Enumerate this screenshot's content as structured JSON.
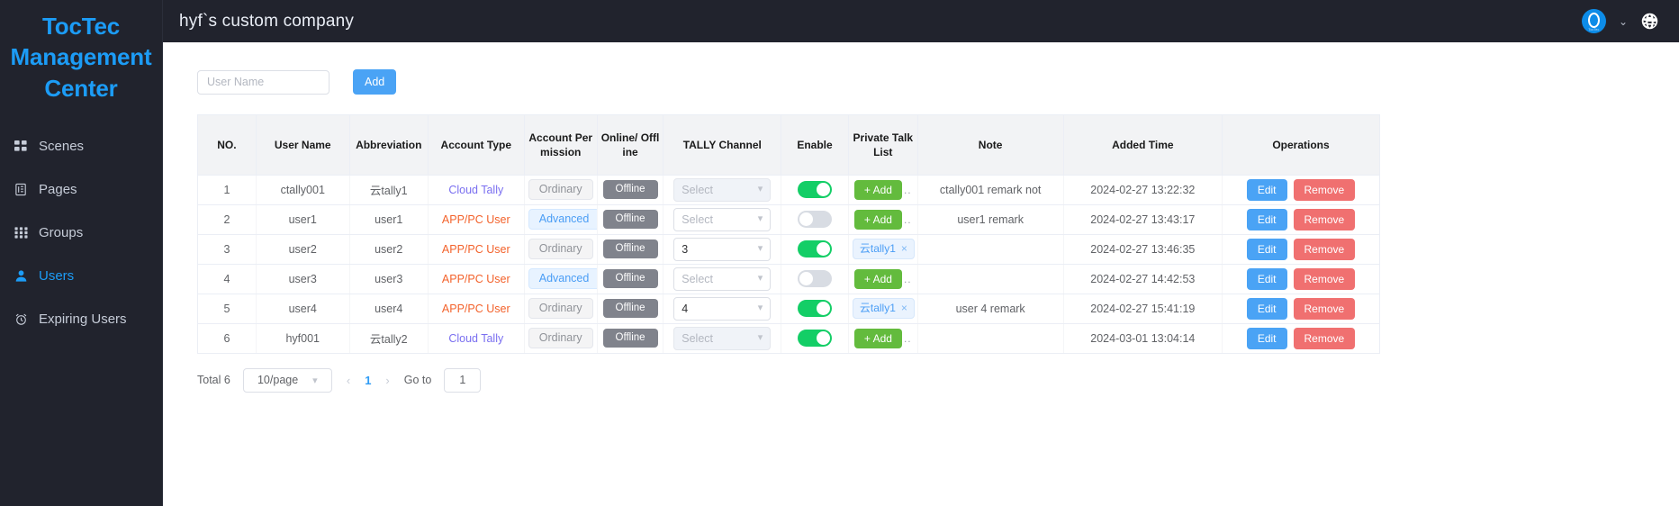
{
  "sidebar": {
    "brand": "TocTec Management Center",
    "items": [
      {
        "label": "Scenes",
        "icon": "grid-2x2-icon",
        "active": false
      },
      {
        "label": "Pages",
        "icon": "document-icon",
        "active": false
      },
      {
        "label": "Groups",
        "icon": "grid-3x3-icon",
        "active": false
      },
      {
        "label": "Users",
        "icon": "user-icon",
        "active": true
      },
      {
        "label": "Expiring Users",
        "icon": "alarm-clock-icon",
        "active": false
      }
    ]
  },
  "topbar": {
    "title": "hyf`s custom company",
    "avatar_caption": "TocTec",
    "chevron": "⌄",
    "globe_icon": "globe-icon"
  },
  "toolbar": {
    "search_placeholder": "User Name",
    "search_value": "",
    "add_label": "Add"
  },
  "table": {
    "headers": [
      "NO.",
      "User Name",
      "Abbreviation",
      "Account Type",
      "Account Permission",
      "Online/ Offline",
      "TALLY Channel",
      "Enable",
      "Private Talk List",
      "Note",
      "Added Time",
      "Operations"
    ],
    "select_placeholder": "Select",
    "offline_label": "Offline",
    "add_tag_label": "+ Add",
    "more_ellipsis": "..",
    "edit_label": "Edit",
    "remove_label": "Remove",
    "tag_close": "×",
    "rows": [
      {
        "no": "1",
        "user_name": "ctally001",
        "abbreviation": "云tally1",
        "account_type": "Cloud Tally",
        "account_type_kind": "cloud",
        "permission": "Ordinary",
        "permission_kind": "ordinary",
        "permission_more": "",
        "online": "Offline",
        "tally_channel": "",
        "tally_disabled": true,
        "enabled": true,
        "talk_kind": "add",
        "talk_tag": "",
        "talk_more": "..",
        "note": "ctally001 remark not",
        "added_time": "2024-02-27 13:22:32"
      },
      {
        "no": "2",
        "user_name": "user1",
        "abbreviation": "user1",
        "account_type": "APP/PC User",
        "account_type_kind": "app",
        "permission": "Advanced",
        "permission_kind": "advanced",
        "permission_more": "..",
        "online": "Offline",
        "tally_channel": "",
        "tally_disabled": false,
        "enabled": false,
        "talk_kind": "add",
        "talk_tag": "",
        "talk_more": "..",
        "note": "user1 remark",
        "added_time": "2024-02-27 13:43:17"
      },
      {
        "no": "3",
        "user_name": "user2",
        "abbreviation": "user2",
        "account_type": "APP/PC User",
        "account_type_kind": "app",
        "permission": "Ordinary",
        "permission_kind": "ordinary",
        "permission_more": "",
        "online": "Offline",
        "tally_channel": "3",
        "tally_disabled": false,
        "enabled": true,
        "talk_kind": "tag",
        "talk_tag": "云tally1",
        "talk_more": "",
        "note": "",
        "added_time": "2024-02-27 13:46:35"
      },
      {
        "no": "4",
        "user_name": "user3",
        "abbreviation": "user3",
        "account_type": "APP/PC User",
        "account_type_kind": "app",
        "permission": "Advanced",
        "permission_kind": "advanced",
        "permission_more": "..",
        "online": "Offline",
        "tally_channel": "",
        "tally_disabled": false,
        "enabled": false,
        "talk_kind": "add",
        "talk_tag": "",
        "talk_more": "..",
        "note": "",
        "added_time": "2024-02-27 14:42:53"
      },
      {
        "no": "5",
        "user_name": "user4",
        "abbreviation": "user4",
        "account_type": "APP/PC User",
        "account_type_kind": "app",
        "permission": "Ordinary",
        "permission_kind": "ordinary",
        "permission_more": "",
        "online": "Offline",
        "tally_channel": "4",
        "tally_disabled": false,
        "enabled": true,
        "talk_kind": "tag",
        "talk_tag": "云tally1",
        "talk_more": "",
        "note": "user 4 remark",
        "added_time": "2024-02-27 15:41:19"
      },
      {
        "no": "6",
        "user_name": "hyf001",
        "abbreviation": "云tally2",
        "account_type": "Cloud Tally",
        "account_type_kind": "cloud",
        "permission": "Ordinary",
        "permission_kind": "ordinary",
        "permission_more": "",
        "online": "Offline",
        "tally_channel": "",
        "tally_disabled": true,
        "enabled": true,
        "talk_kind": "add",
        "talk_tag": "",
        "talk_more": "..",
        "note": "",
        "added_time": "2024-03-01 13:04:14"
      }
    ]
  },
  "pagination": {
    "total_label": "Total 6",
    "page_size": "10/page",
    "prev": "‹",
    "current_page": "1",
    "next": "›",
    "goto_label": "Go to",
    "goto_value": "1"
  },
  "colors": {
    "brand_blue": "#1c9cf6",
    "sidebar_bg": "#21232d",
    "cloud_tally": "#7a6ff0",
    "app_user": "#f3622b",
    "switch_on": "#13ce66",
    "add_green": "#63bb3d",
    "edit_blue": "#4aa3f5",
    "remove_red": "#f07070"
  }
}
